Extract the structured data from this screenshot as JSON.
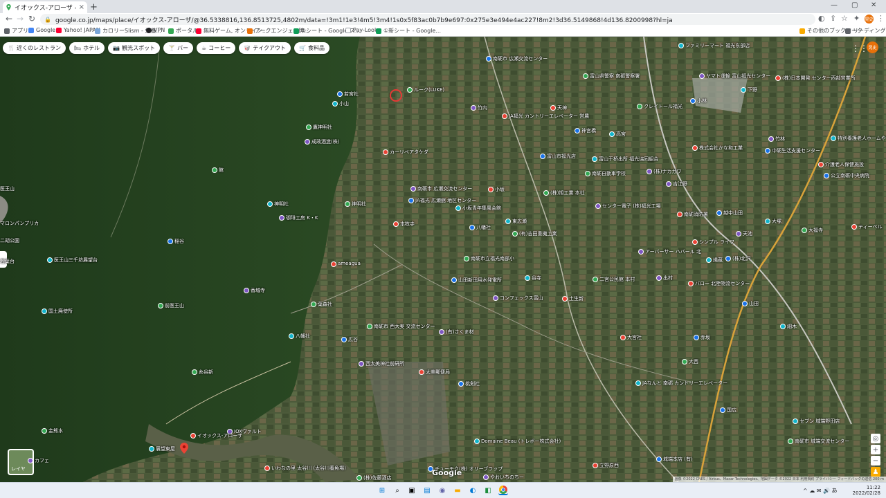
{
  "browser": {
    "tab_title": "イオックス-アローザ - Googleマップ",
    "tab_close": "×",
    "new_tab": "+",
    "window_controls": [
      "—",
      "▢",
      "✕"
    ],
    "url": "google.co.jp/maps/place/イオックス-アローザ/@36.5338816,136.8513725,4802m/data=!3m1!1e3!4m5!3m4!1s0x5f83ac0b7b9e697:0x275e3e494e4ac227!8m2!3d36.5149868!4d136.8200998?hl=ja"
  },
  "bookmarks": {
    "items": [
      {
        "label": "アプリ",
        "color": "#5f6368"
      },
      {
        "label": "Google",
        "color": "#4285f4"
      },
      {
        "label": "Yahoo! JAPAN",
        "color": "#ff0033"
      },
      {
        "label": "カロリーSlism - 栄養...",
        "color": "#7aa6d8"
      },
      {
        "label": "VPN",
        "color": "#202124"
      },
      {
        "label": "ポータル",
        "color": "#34a853"
      },
      {
        "label": "無料ゲーム, オンライン...",
        "color": "#ff0033"
      },
      {
        "label": "アークエンジェル牌...",
        "color": "#e8710a"
      },
      {
        "label": "②シート - Google ス...",
        "color": "#0f9d58"
      },
      {
        "label": "Pay-Look",
        "color": "#ffffff"
      },
      {
        "label": "①新シート - Google...",
        "color": "#0f9d58"
      }
    ],
    "others": "その他のブックマーク",
    "reading_list": "リーディング リスト"
  },
  "chips": [
    {
      "icon": "🍴",
      "label": "近くのレストラン"
    },
    {
      "icon": "🛏",
      "label": "ホテル"
    },
    {
      "icon": "📷",
      "label": "観光スポット"
    },
    {
      "icon": "🍸",
      "label": "バー"
    },
    {
      "icon": "☕",
      "label": "コーヒー"
    },
    {
      "icon": "🥡",
      "label": "テイクアウト"
    },
    {
      "icon": "🛒",
      "label": "食料品"
    }
  ],
  "map_labels": [
    "南砺市 広瀬交流センター",
    "ファミリーマート 福光东部店",
    "富山県警察 南砺警察署",
    "ヤマト運輸 富山福光センター",
    "(株)日本開発 センター西部営業所",
    "若宮社",
    "小山",
    "ルーク(LUKE)",
    "竹内",
    "天神",
    "小林",
    "下野",
    "鷹神明社",
    "成政酒造(株)",
    "JA福光 カントリーエレベーター 営農",
    "神宮橋",
    "高宮",
    "クレイトール福光",
    "竹林",
    "カーリベアタケダ",
    "富山市福光店",
    "富山干桥出所 福光協同組合",
    "南砺自動車学校",
    "(株)ナカガワ",
    "株式会社かな和工業",
    "中砺生活支援センター",
    "特別養護老人ホームやすらぎ",
    "館",
    "南砺市 広瀬交流センター",
    "小坂",
    "JA福光 広瀬舘 地区センター",
    "小坂青年集風会館",
    "(株)旭工業 本社",
    "吉江野",
    "介護老人保健施設",
    "公立南砺中央病院",
    "神明社",
    "神明社",
    "センター電子 (株)福光工場",
    "南砺消防署",
    "越中山田",
    "大塚",
    "大福寺",
    "珈琲工房 K・K",
    "本牧寺",
    "八幡社",
    "東広瀬",
    "(有)吉田重機工業",
    "天池",
    "ティーベル",
    "稲谷",
    "医王山三千坊展望台",
    "南砺市立福光南部小",
    "アーバーサー ハバール 北",
    "シンプル ライフ",
    "(株)北沢",
    "縄蔵",
    "前医王山",
    "香城寺",
    "ameagua",
    "山田新田用水発電所",
    "谷寺",
    "二宮公民館 本村",
    "出村",
    "バロー 北陸物流センター",
    "山田",
    "国土廃使所",
    "葉森社",
    "コンフェックス富山",
    "土生新",
    "広谷",
    "八幡社",
    "南砺市 西大美 交流センター",
    "(有)さくま材",
    "大宮社",
    "赤坂",
    "細木",
    "大西",
    "西太美神社前研所",
    "太美郵便局",
    "桃剣社",
    "JAなんと 南砺 カントリーエレベーター",
    "糸谷新",
    "IOXヴァルト",
    "イオックス-アローザ",
    "国広",
    "展望東屋",
    "金熊水",
    "カフェ",
    "いわなの里 太谷川 (太谷川養魚場)",
    "チューモク(株) オリーブラップ",
    "Domaine Beau (トレボー株式会社)",
    "(株)佐藤酒店",
    "やおいちのちー",
    "立野原西",
    "城端本店 (有)",
    "セブン 城端野田店",
    "南砺市 城端交流センター",
    "医王山",
    "マロンパンプリカ",
    "二胡公園",
    "若葉台"
  ],
  "map_controls": {
    "layers_label": "レイヤ",
    "zoom_in": "+",
    "zoom_out": "−",
    "google_logo": "Google",
    "attribution": "画像 ©2022 CNES / Airbus、Maxar Technologies、地図データ ©2022  日本  利用規約  プライバシー  フィードバックの送信  200 m"
  },
  "user": {
    "initials": "晃史"
  },
  "taskbar": {
    "time": "11:22",
    "date": "2022/02/28",
    "tray": "^ ☁ ✉ 🔊 あ"
  }
}
